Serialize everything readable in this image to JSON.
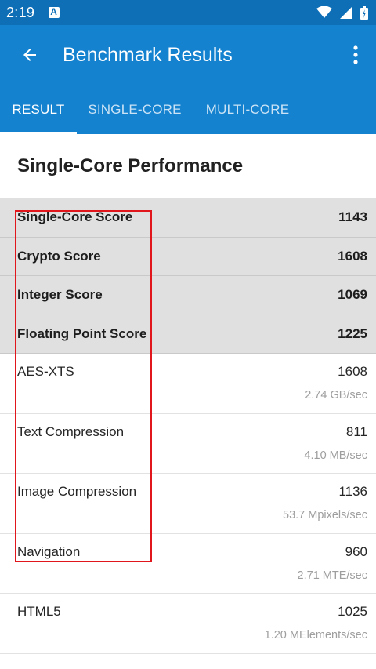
{
  "status_bar": {
    "time": "2:19",
    "notification_icon": "a-badge-icon",
    "icons": [
      "wifi-icon",
      "signal-icon",
      "battery-icon"
    ]
  },
  "app_bar": {
    "title": "Benchmark Results",
    "back_icon": "arrow-back-icon",
    "menu_icon": "more-vert-icon"
  },
  "tabs": [
    {
      "label": "RESULT",
      "active": true
    },
    {
      "label": "SINGLE-CORE",
      "active": false
    },
    {
      "label": "MULTI-CORE",
      "active": false
    }
  ],
  "section": {
    "title": "Single-Core Performance"
  },
  "summary_rows": [
    {
      "name": "Single-Core Score",
      "score": "1143"
    },
    {
      "name": "Crypto Score",
      "score": "1608"
    },
    {
      "name": "Integer Score",
      "score": "1069"
    },
    {
      "name": "Floating Point Score",
      "score": "1225"
    }
  ],
  "detail_rows": [
    {
      "name": "AES-XTS",
      "score": "1608",
      "rate": "2.74 GB/sec"
    },
    {
      "name": "Text Compression",
      "score": "811",
      "rate": "4.10 MB/sec"
    },
    {
      "name": "Image Compression",
      "score": "1136",
      "rate": "53.7 Mpixels/sec"
    },
    {
      "name": "Navigation",
      "score": "960",
      "rate": "2.71 MTE/sec"
    },
    {
      "name": "HTML5",
      "score": "1025",
      "rate": "1.20 MElements/sec"
    }
  ],
  "colors": {
    "status_bar": "#0e6fb7",
    "app_bar": "#1582d0",
    "summary_bg": "#e0e0e0",
    "highlight": "#e0161c"
  }
}
